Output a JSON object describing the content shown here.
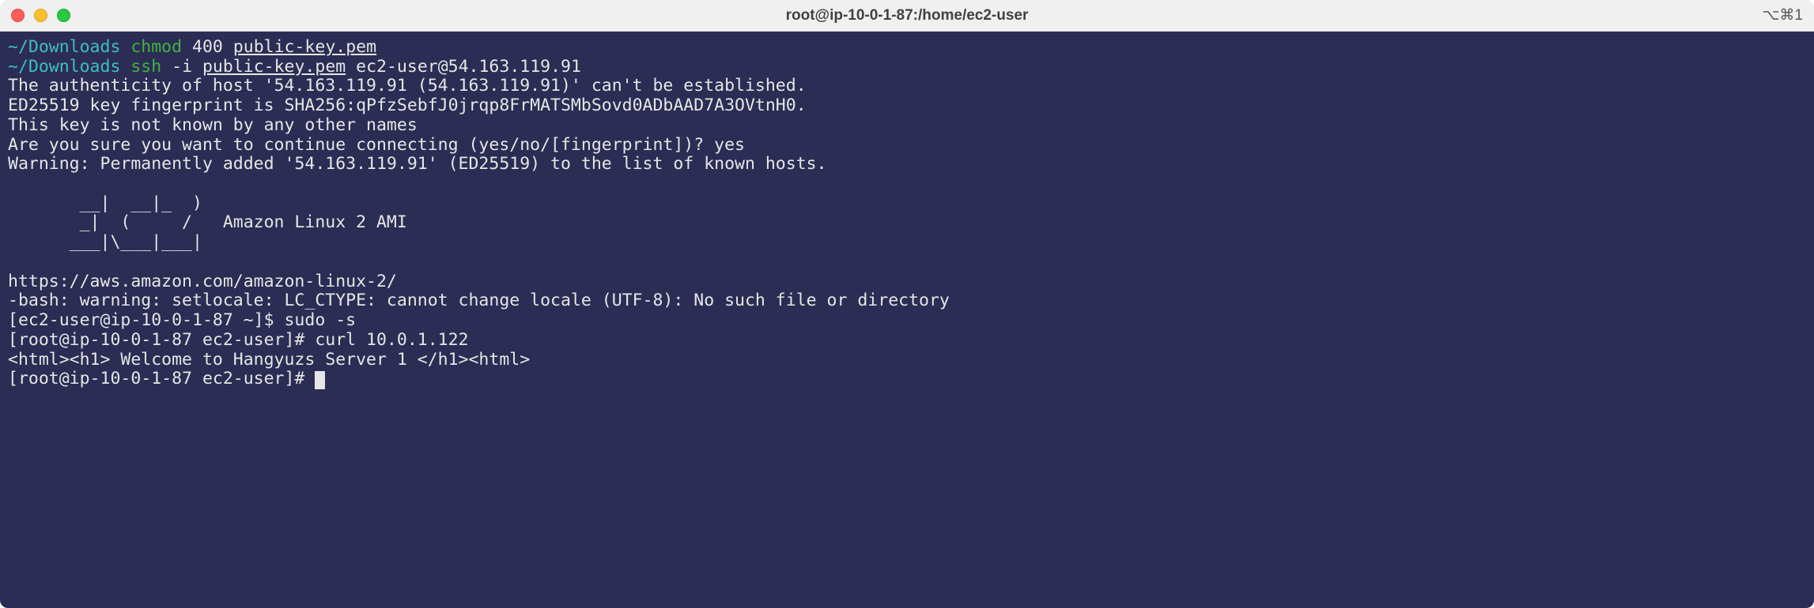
{
  "window": {
    "title": "root@ip-10-0-1-87:/home/ec2-user",
    "shortcut": "⌥⌘1"
  },
  "terminal": {
    "line1_dir": "~/Downloads",
    "line1_cmd": "chmod",
    "line1_args": "400",
    "line1_file": "public-key.pem",
    "line2_dir": "~/Downloads",
    "line2_cmd": "ssh",
    "line2_arg1": "-i",
    "line2_file": "public-key.pem",
    "line2_host": "ec2-user@54.163.119.91",
    "line3": "The authenticity of host '54.163.119.91 (54.163.119.91)' can't be established.",
    "line4": "ED25519 key fingerprint is SHA256:qPfzSebfJ0jrqp8FrMATSMbSovd0ADbAAD7A3OVtnH0.",
    "line5": "This key is not known by any other names",
    "line6": "Are you sure you want to continue connecting (yes/no/[fingerprint])? yes",
    "line7": "Warning: Permanently added '54.163.119.91' (ED25519) to the list of known hosts.",
    "line8": "",
    "line9": "       __|  __|_  )",
    "line10": "       _|  (     /   Amazon Linux 2 AMI",
    "line11": "      ___|\\___|___|",
    "line12": "",
    "line13": "https://aws.amazon.com/amazon-linux-2/",
    "line14": "-bash: warning: setlocale: LC_CTYPE: cannot change locale (UTF-8): No such file or directory",
    "line15": "[ec2-user@ip-10-0-1-87 ~]$ sudo -s",
    "line16": "[root@ip-10-0-1-87 ec2-user]# curl 10.0.1.122",
    "line17": "<html><h1> Welcome to Hangyuzs Server 1 </h1><html>",
    "line18": "[root@ip-10-0-1-87 ec2-user]# "
  }
}
